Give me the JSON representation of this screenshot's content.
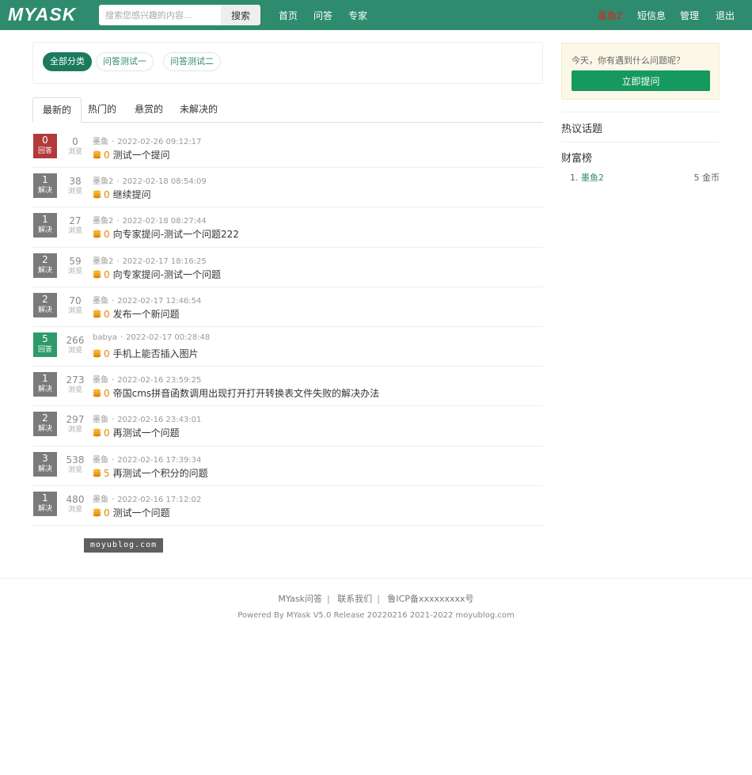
{
  "header": {
    "logo": "MYASK",
    "search_placeholder": "搜索您感兴趣的内容...",
    "search_button": "搜索",
    "nav": [
      "首页",
      "问答",
      "专家"
    ],
    "user": "墨鱼2",
    "messages": "短信息",
    "admin": "管理",
    "logout": "退出"
  },
  "categories": [
    "全部分类",
    "问答测试一",
    "问答测试二"
  ],
  "tabs": [
    "最新的",
    "热门的",
    "悬赏的",
    "未解决的"
  ],
  "questions": [
    {
      "answers": "0",
      "answer_label": "回答",
      "status": "unanswered",
      "views": "0",
      "views_label": "浏览",
      "author": "墨鱼",
      "time": "2022-02-26 09:12:17",
      "reward": "0",
      "title": "测试一个提问"
    },
    {
      "answers": "1",
      "answer_label": "解决",
      "status": "solved",
      "views": "38",
      "views_label": "浏览",
      "author": "墨鱼2",
      "time": "2022-02-18 08:54:09",
      "reward": "0",
      "title": "继续提问"
    },
    {
      "answers": "1",
      "answer_label": "解决",
      "status": "solved",
      "views": "27",
      "views_label": "浏览",
      "author": "墨鱼2",
      "time": "2022-02-18 08:27:44",
      "reward": "0",
      "title": "向专家提问-测试一个问题222"
    },
    {
      "answers": "2",
      "answer_label": "解决",
      "status": "solved",
      "views": "59",
      "views_label": "浏览",
      "author": "墨鱼2",
      "time": "2022-02-17 18:16:25",
      "reward": "0",
      "title": "向专家提问-测试一个问题"
    },
    {
      "answers": "2",
      "answer_label": "解决",
      "status": "solved",
      "views": "70",
      "views_label": "浏览",
      "author": "墨鱼",
      "time": "2022-02-17 12:46:54",
      "reward": "0",
      "title": "发布一个新问题"
    },
    {
      "answers": "5",
      "answer_label": "回答",
      "status": "answered",
      "views": "266",
      "views_label": "浏览",
      "author": "babya",
      "time": "2022-02-17 00:28:48",
      "reward": "0",
      "title": "手机上能否插入图片"
    },
    {
      "answers": "1",
      "answer_label": "解决",
      "status": "solved",
      "views": "273",
      "views_label": "浏览",
      "author": "墨鱼",
      "time": "2022-02-16 23:59:25",
      "reward": "0",
      "title": "帝国cms拼音函数调用出现打开打开转换表文件失败的解决办法"
    },
    {
      "answers": "2",
      "answer_label": "解决",
      "status": "solved",
      "views": "297",
      "views_label": "浏览",
      "author": "墨鱼",
      "time": "2022-02-16 23:43:01",
      "reward": "0",
      "title": "再测试一个问题"
    },
    {
      "answers": "3",
      "answer_label": "解决",
      "status": "solved",
      "views": "538",
      "views_label": "浏览",
      "author": "墨鱼",
      "time": "2022-02-16 17:39:34",
      "reward": "5",
      "title": "再测试一个积分的问题"
    },
    {
      "answers": "1",
      "answer_label": "解决",
      "status": "solved",
      "views": "480",
      "views_label": "浏览",
      "author": "墨鱼",
      "time": "2022-02-16 17:12:02",
      "reward": "0",
      "title": "测试一个问题"
    }
  ],
  "watermark": "moyublog.com",
  "sidebar": {
    "ask_prompt": "今天，你有遇到什么问题呢？",
    "ask_button": "立即提问",
    "hot_topics_title": "热议话题",
    "wealth_title": "财富榜",
    "ranking": [
      {
        "rank": "1.",
        "name": "墨鱼2",
        "coins": "5 金币"
      }
    ]
  },
  "footer": {
    "links": [
      "MYask问答",
      "联系我们",
      "鲁ICP备xxxxxxxxx号"
    ],
    "powered": "Powered By MYask V5.0 Release 20220216 2021-2022 moyublog.com"
  },
  "colors": {
    "brand": "#2e8b6e",
    "unanswered": "#b23a3a",
    "solved": "#7a7a7a",
    "answered": "#2e9a6a",
    "reward": "#e08a0b"
  }
}
